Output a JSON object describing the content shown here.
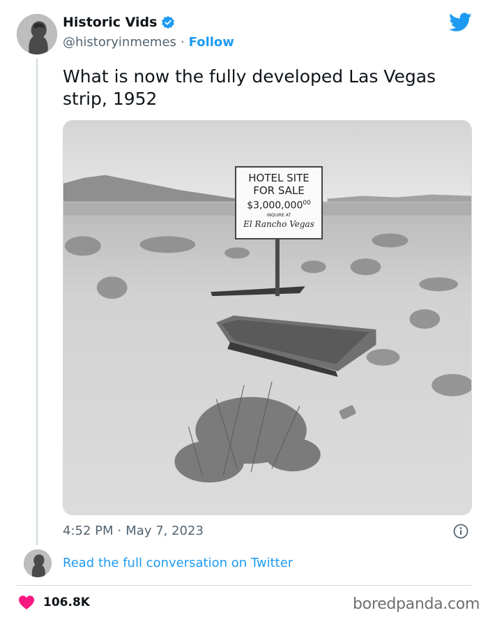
{
  "author": {
    "display_name": "Historic Vids",
    "handle": "@historyinmemes",
    "separator": "·",
    "follow_label": "Follow"
  },
  "tweet": {
    "text": "What is now the fully developed Las Vegas strip, 1952",
    "time": "4:52 PM",
    "date_separator": "·",
    "date": "May 7, 2023"
  },
  "photo": {
    "sign": {
      "line1": "HOTEL SITE",
      "line2": "FOR SALE",
      "price": "$3,000,000",
      "price_cents": "00",
      "inquire": "INQUIRE AT",
      "venue": "El Rancho Vegas"
    }
  },
  "footer": {
    "read_link": "Read the full conversation on Twitter",
    "like_count": "106.8K"
  },
  "watermark": "boredpanda.com",
  "colors": {
    "accent": "#1d9bf0",
    "heart": "#f91880",
    "text": "#0f1419",
    "muted": "#536471"
  },
  "icons": [
    "verified-badge-icon",
    "twitter-bird-icon",
    "info-icon",
    "heart-icon"
  ]
}
